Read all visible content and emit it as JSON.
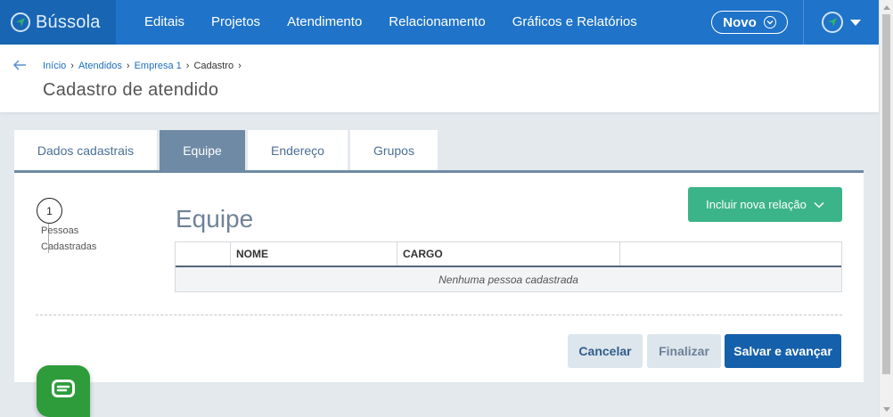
{
  "app": {
    "brand": "Bússola",
    "brand_color": "#1f73c8"
  },
  "nav": {
    "items": [
      {
        "label": "Editais"
      },
      {
        "label": "Projetos"
      },
      {
        "label": "Atendimento"
      },
      {
        "label": "Relacionamento"
      },
      {
        "label": "Gráficos e Relatórios"
      }
    ],
    "novo_label": "Novo"
  },
  "header": {
    "breadcrumb": [
      "Início",
      "Atendidos",
      "Empresa 1",
      "Cadastro"
    ],
    "title": "Cadastro de atendido"
  },
  "tabs": [
    {
      "label": "Dados cadastrais",
      "active": false
    },
    {
      "label": "Equipe",
      "active": true
    },
    {
      "label": "Endereço",
      "active": false
    },
    {
      "label": "Grupos",
      "active": false
    }
  ],
  "steps": {
    "number": "1",
    "label": "Pessoas Cadastradas"
  },
  "section": {
    "title": "Equipe",
    "include_label": "Incluir nova relação"
  },
  "table": {
    "columns": [
      "",
      "NOME",
      "CARGO",
      ""
    ],
    "empty_message": "Nenhuma pessoa cadastrada"
  },
  "actions": {
    "cancel": "Cancelar",
    "finish": "Finalizar",
    "save": "Salvar e avançar"
  },
  "colors": {
    "accent_green": "#3cb489",
    "save_blue": "#1560aa",
    "tab_active": "#6e8aa5",
    "chat_green": "#2f9c3c"
  }
}
